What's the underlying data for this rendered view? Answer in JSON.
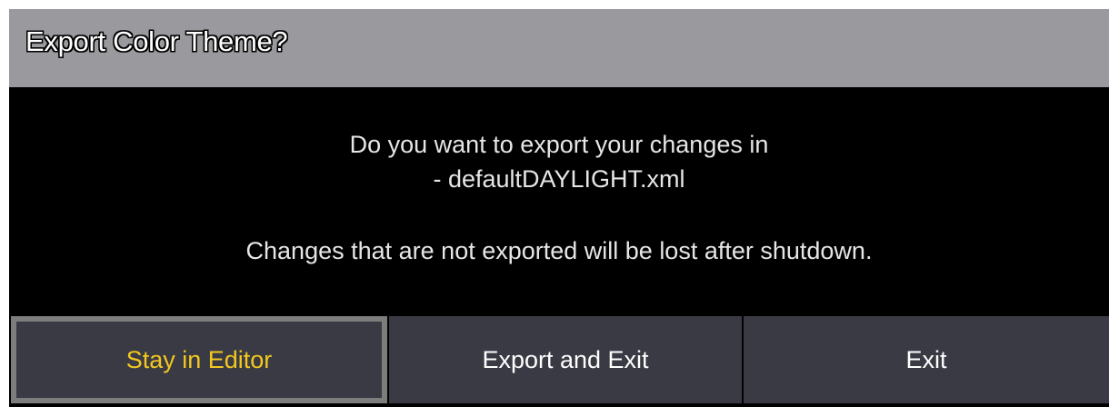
{
  "dialog": {
    "title": "Export Color Theme?",
    "message": {
      "line1": "Do you want to export your changes in",
      "line2": "-  defaultDAYLIGHT.xml",
      "line3": "Changes that are not exported will be lost after shutdown."
    },
    "buttons": {
      "stay": "Stay in Editor",
      "export_exit": "Export and Exit",
      "exit": "Exit"
    },
    "colors": {
      "title_bar": "#9a9a9e",
      "background": "#000000",
      "button": "#3a3a44",
      "focused_text": "#f2c81e",
      "focus_border": "#7d7d7d"
    }
  }
}
